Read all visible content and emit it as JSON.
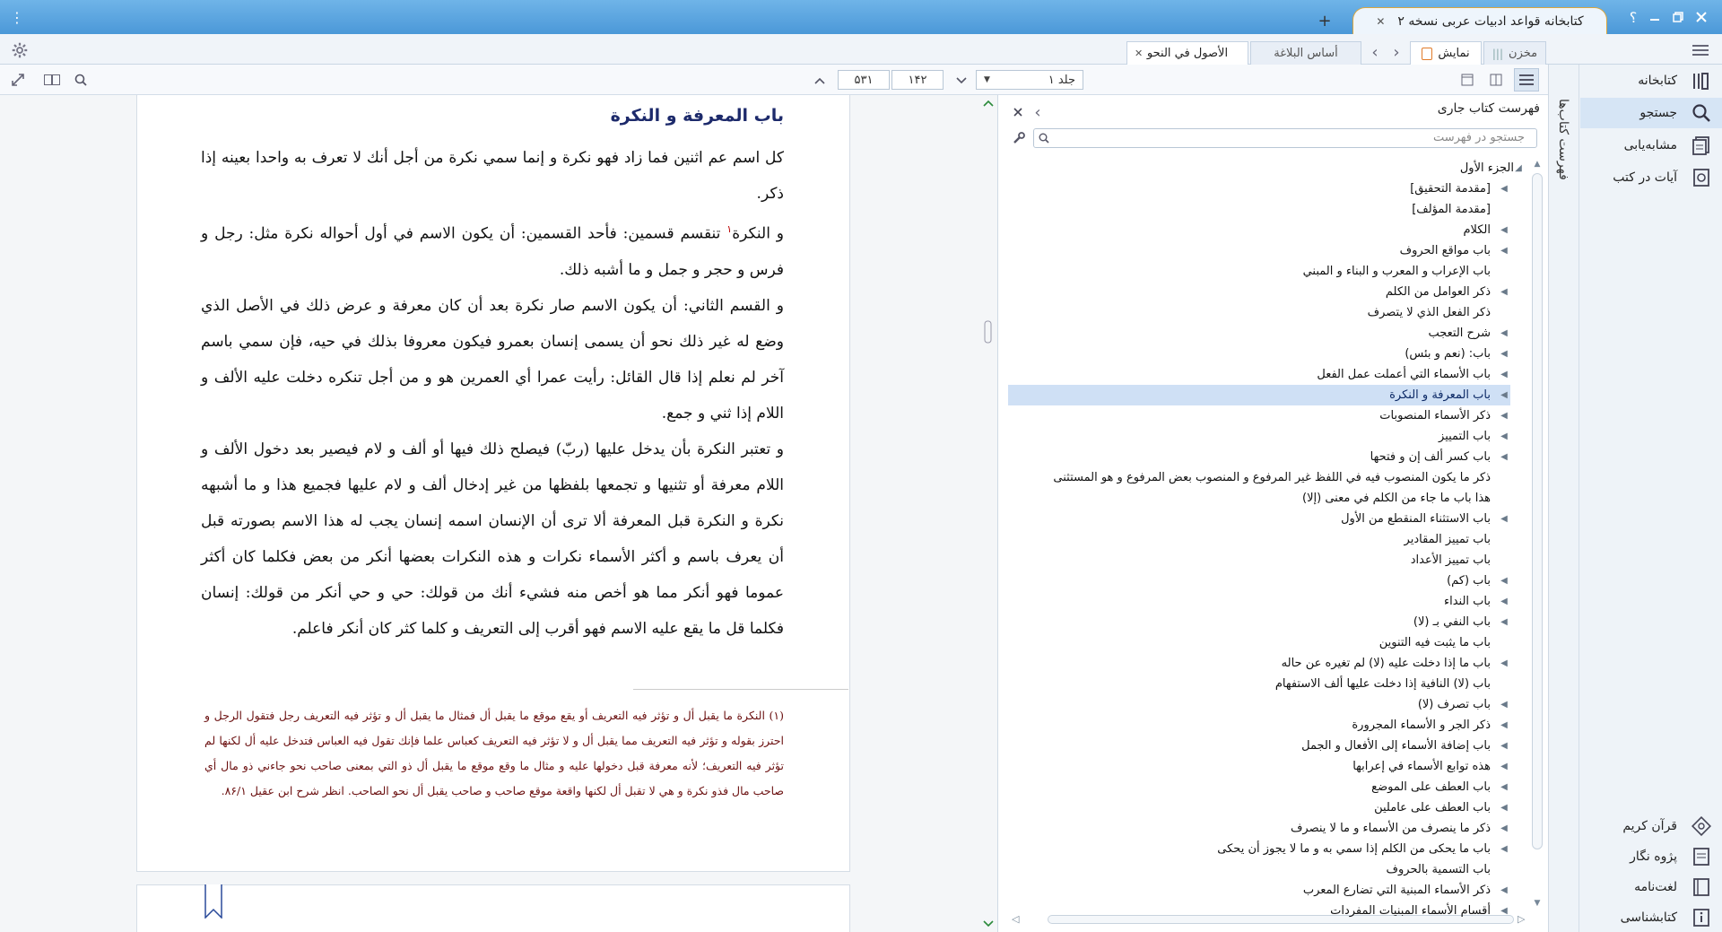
{
  "window": {
    "title": "کتابخانه قواعد ادبیات عربی نسخه ۲",
    "help_label": "؟",
    "menu_glyph": "⋮",
    "add_tab_glyph": "+"
  },
  "tabs": [
    {
      "label": "الأصول في النحو",
      "active": true
    },
    {
      "label": "أساس البلاغة",
      "active": false
    }
  ],
  "view_toggle": {
    "display_label": "نمایش",
    "store_label": "مخزن"
  },
  "navigation": {
    "volume_label": "جلد ۱",
    "page_number": "۱۴۲",
    "total_pages": "۵۳۱"
  },
  "content": {
    "heading": "باب المعرفة و النكرة",
    "paragraphs": [
      "كل اسم عم اثنين فما زاد فهو نكرة و إنما سمي نكرة من أجل أنك لا تعرف به واحدا بعينه إذا ذكر.",
      "و النكرة",
      "تنقسم قسمين: فأحد القسمين: أن يكون الاسم في أول أحواله نكرة مثل: رجل و فرس و حجر و جمل و ما أشبه ذلك.",
      "و القسم الثاني: أن يكون الاسم صار نكرة بعد أن كان معرفة و عرض ذلك في الأصل الذي وضع له غير ذلك نحو أن يسمى إنسان بعمرو فيكون معروفا بذلك في حيه، فإن سمي باسم آخر لم نعلم إذا قال القائل: رأيت عمرا أي العمرين هو و من أجل تنكره دخلت عليه الألف و اللام إذا ثني و جمع.",
      "و تعتبر النكرة بأن يدخل عليها (ربّ) فيصلح ذلك فيها أو ألف و لام فيصير بعد دخول الألف و اللام معرفة أو تثنيها و تجمعها بلفظها من غير إدخال ألف و لام عليها فجميع هذا و ما أشبهه نكرة و النكرة قبل المعرفة ألا ترى أن الإنسان اسمه إنسان يجب له هذا الاسم بصورته قبل أن يعرف باسم و أكثر الأسماء نكرات و هذه النكرات بعضها أنكر من بعض فكلما كان أكثر عموما فهو أنكر مما هو أخص منه فشيء أنك من قولك: حي و حي أنكر من قولك: إنسان فكلما قل ما يقع عليه الاسم فهو أقرب إلى التعريف و كلما كثر كان أنكر فاعلم."
    ],
    "footnote_marker": "۱",
    "footnote": "(۱) النكرة ما يقبل أل و تؤثر فيه التعريف أو يقع موقع ما يقبل أل فمثال ما يقبل أل و تؤثر فيه التعريف رجل فتقول الرجل و احترز بقوله و تؤثر فيه التعريف مما يقبل أل و لا تؤثر فيه التعريف كعباس علما فإنك تقول فيه العباس فتدخل عليه أل لكنها لم تؤثر فيه التعريف؛ لأنه معرفة قبل دخولها عليه و مثال ما وقع موقع ما يقبل أل ذو التي بمعنى صاحب نحو جاءني ذو مال أي صاحب مال فذو نكرة و هي لا تقبل أل لكنها واقعة موقع صاحب و صاحب يقبل أل نحو الصاحب. انظر شرح ابن عقيل ۸۶/۱."
  },
  "toc": {
    "title": "فهرست کتاب جاری",
    "search_placeholder": "جستجو در فهرست",
    "root": "الجزء الأول",
    "items": [
      {
        "label": "[مقدمة التحقيق]",
        "has_children": true
      },
      {
        "label": "[مقدمة المؤلف]",
        "has_children": false
      },
      {
        "label": "الكلام",
        "has_children": true
      },
      {
        "label": "باب مواقع الحروف",
        "has_children": true
      },
      {
        "label": "باب الإعراب و المعرب و البناء و المبني",
        "has_children": false
      },
      {
        "label": "ذكر العوامل من الكلم",
        "has_children": true
      },
      {
        "label": "ذكر الفعل الذي لا يتصرف",
        "has_children": false
      },
      {
        "label": "شرح التعجب",
        "has_children": true
      },
      {
        "label": "باب: (نعم و بئس)",
        "has_children": true
      },
      {
        "label": "باب الأسماء التي أعملت عمل الفعل",
        "has_children": true
      },
      {
        "label": "باب المعرفة و النكرة",
        "has_children": true,
        "selected": true
      },
      {
        "label": "ذكر الأسماء المنصوبات",
        "has_children": true
      },
      {
        "label": "باب التمييز",
        "has_children": true
      },
      {
        "label": "باب كسر ألف إن و فتحها",
        "has_children": true
      },
      {
        "label": "ذكر ما يكون المنصوب فيه في اللفظ غير المرفوع و المنصوب بعض المرفوع و هو المستثنى",
        "has_children": false
      },
      {
        "label": "هذا باب ما جاء من الكلم في معنى (إلا)",
        "has_children": false
      },
      {
        "label": "باب الاستثناء المنقطع من الأول",
        "has_children": true
      },
      {
        "label": "باب تمييز المقادير",
        "has_children": false
      },
      {
        "label": "باب تمييز الأعداد",
        "has_children": false
      },
      {
        "label": "باب (كم)",
        "has_children": true
      },
      {
        "label": "باب النداء",
        "has_children": true
      },
      {
        "label": "باب النفي بـ (لا)",
        "has_children": true
      },
      {
        "label": "باب ما يثبت فيه التنوين",
        "has_children": false
      },
      {
        "label": "باب ما إذا دخلت عليه (لا) لم تغيره عن حاله",
        "has_children": true
      },
      {
        "label": "باب (لا) النافية إذا دخلت عليها ألف الاستفهام",
        "has_children": false
      },
      {
        "label": "باب تصرف (لا)",
        "has_children": true
      },
      {
        "label": "ذكر الجر و الأسماء المجرورة",
        "has_children": true
      },
      {
        "label": "باب إضافة الأسماء إلى الأفعال و الجمل",
        "has_children": true
      },
      {
        "label": "هذه توابع الأسماء في إعرابها",
        "has_children": true
      },
      {
        "label": "باب العطف على الموضع",
        "has_children": true
      },
      {
        "label": "باب العطف على عاملين",
        "has_children": true
      },
      {
        "label": "ذكر ما ينصرف من الأسماء و ما لا ينصرف",
        "has_children": true
      },
      {
        "label": "باب ما يحكى من الكلم إذا سمي به و ما لا يجوز أن يحكى",
        "has_children": true
      },
      {
        "label": "باب التسمية بالحروف",
        "has_children": false
      },
      {
        "label": "ذكر الأسماء المبنية التي تضارع المعرب",
        "has_children": true
      },
      {
        "label": "أقسام الأسماء المبنيات المفردات",
        "has_children": true
      }
    ]
  },
  "side_panel_label": "فهرست کتاب‌ها",
  "sidebar": {
    "top": [
      {
        "label": "کتابخانه",
        "icon": "books-icon"
      },
      {
        "label": "جستجو",
        "icon": "search-icon",
        "selected": true
      },
      {
        "label": "مشابه‌یابی",
        "icon": "similar-icon"
      },
      {
        "label": "آیات در کتب",
        "icon": "verses-icon"
      }
    ],
    "bottom": [
      {
        "label": "قرآن کریم",
        "icon": "quran-icon"
      },
      {
        "label": "پژوه نگار",
        "icon": "notes-icon"
      },
      {
        "label": "لغت‌نامه",
        "icon": "dictionary-icon"
      },
      {
        "label": "کتابشناسی",
        "icon": "info-icon"
      }
    ]
  },
  "colors": {
    "titlebar": "#5aa6e0",
    "accent_tab_border": "#d9a640",
    "heading": "#1d2a6b",
    "footnote": "#6b1010",
    "selection": "#cfe0f5"
  }
}
